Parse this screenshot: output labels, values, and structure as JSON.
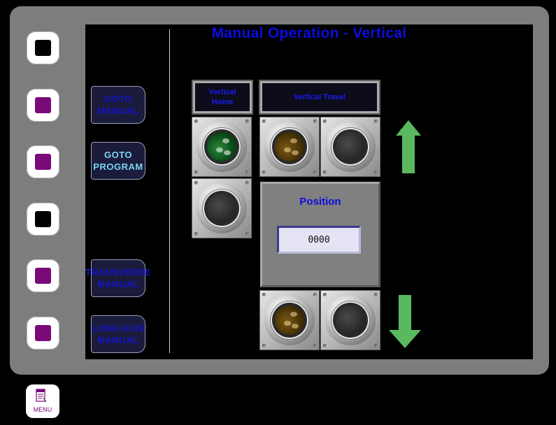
{
  "screen": {
    "title": "Manual Operation - Vertical"
  },
  "nav": {
    "goto_manual": "GOTO\nMANUAL",
    "goto_program": "GOTO\nPROGRAM",
    "transverse_manual": "TRANSVERSE\nMANUAL",
    "long_axis_manual": "LONG AXIS\nMANUAL"
  },
  "labels": {
    "vertical_home": "Vertical\nHome",
    "vertical_travel": "Vertical Travel"
  },
  "position": {
    "label": "Position",
    "value": "0000"
  },
  "menu": {
    "label": "MENU"
  },
  "colors": {
    "title_blue": "#0c0cdd",
    "arrow_green": "#5ab85e",
    "softkey_purple": "#7a0a7a",
    "bezel_gray": "#7d7d7d"
  },
  "indicators": {
    "vertical_home_lamp": "on-green",
    "vertical_home_lamp_2": "off",
    "travel_up_lamp": "amber",
    "travel_up_lamp_2": "off",
    "travel_down_lamp": "amber",
    "travel_down_lamp_2": "off"
  },
  "icons": {
    "up": "arrow-up-icon",
    "down": "arrow-down-icon",
    "menu": "document-icon"
  }
}
